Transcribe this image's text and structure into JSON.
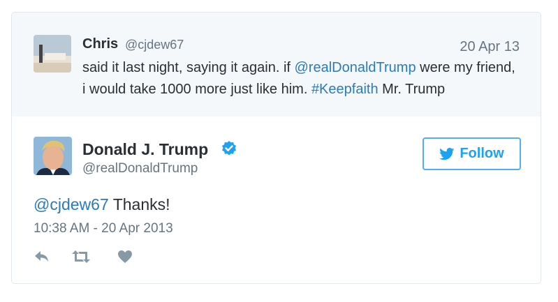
{
  "quoted_tweet": {
    "author_name": "Chris",
    "author_handle": "@cjdew67",
    "date": "20 Apr 13",
    "text_part1": "said it last night, saying it again. if ",
    "mention": "@realDonaldTrump",
    "text_part2": " were my friend, i would take 1000 more just like him. ",
    "hashtag": "#Keepfaith",
    "text_part3": " Mr. Trump"
  },
  "tweet": {
    "author_name": "Donald J. Trump",
    "author_handle": "@realDonaldTrump",
    "mention": "@cjdew67",
    "text": " Thanks!",
    "timestamp": "10:38 AM - 20 Apr 2013"
  },
  "follow_button": {
    "label": "Follow",
    "icon": "twitter-bird-icon"
  },
  "icons": {
    "verified": "verified-badge-icon",
    "reply": "reply-icon",
    "retweet": "retweet-icon",
    "like": "heart-icon"
  },
  "colors": {
    "link": "#2b7bb9",
    "follow_accent": "#1da1f2",
    "verified": "#1da1f2",
    "muted_text": "#66757f",
    "quoted_background": "#f5f8fa"
  }
}
